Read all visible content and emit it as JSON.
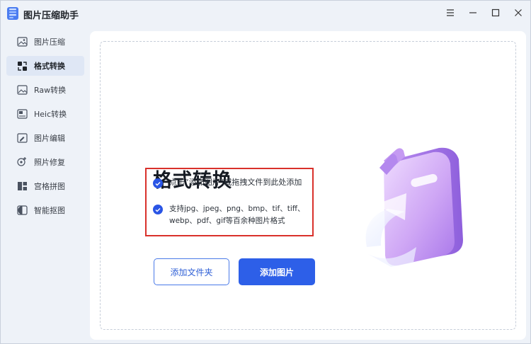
{
  "app": {
    "title": "图片压缩助手"
  },
  "window_controls": [
    {
      "name": "menu-icon"
    },
    {
      "name": "minimize-icon"
    },
    {
      "name": "maximize-icon"
    },
    {
      "name": "close-icon"
    }
  ],
  "sidebar": {
    "items": [
      {
        "label": "图片压缩",
        "icon": "image-compress-icon",
        "active": false
      },
      {
        "label": "格式转换",
        "icon": "format-convert-icon",
        "active": true
      },
      {
        "label": "Raw转换",
        "icon": "raw-image-icon",
        "active": false
      },
      {
        "label": "Heic转换",
        "icon": "heic-image-icon",
        "active": false
      },
      {
        "label": "图片编辑",
        "icon": "image-edit-icon",
        "active": false
      },
      {
        "label": "照片修复",
        "icon": "photo-repair-icon",
        "active": false
      },
      {
        "label": "宫格拼图",
        "icon": "grid-collage-icon",
        "active": false
      },
      {
        "label": "智能抠图",
        "icon": "smart-cutout-icon",
        "active": false
      }
    ]
  },
  "main": {
    "heading": "格式转换",
    "features": [
      "点击“添加图片”或拖拽文件到此处添加",
      "支持jpg、jpeg、png、bmp、tif、tiff、webp、pdf、gif等百余种图片格式"
    ],
    "buttons": {
      "add_folder": "添加文件夹",
      "add_image": "添加图片"
    }
  },
  "colors": {
    "accent": "#2d5fe8",
    "highlight_border": "#d9312b",
    "active_item_bg": "#dfe7f5"
  }
}
